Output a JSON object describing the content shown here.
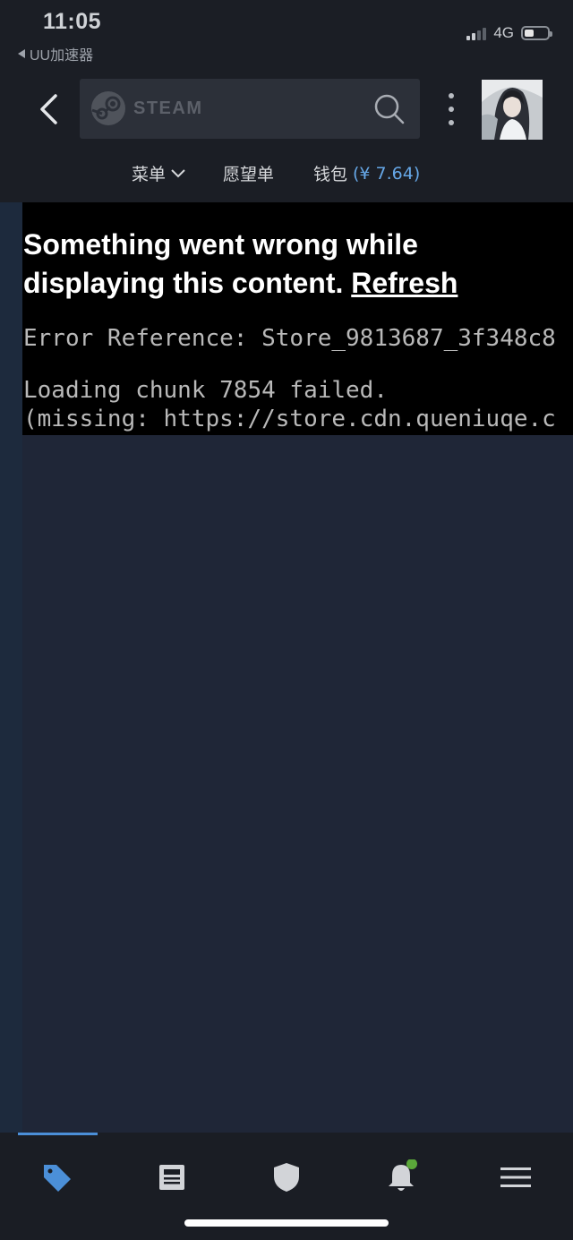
{
  "status_bar": {
    "time": "11:05",
    "back_app": "UU加速器",
    "network": "4G",
    "battery_level": 0.4
  },
  "header": {
    "search_brand": "STEAM",
    "nav": {
      "menu_label": "菜单",
      "wishlist_label": "愿望单",
      "wallet_label": "钱包",
      "wallet_balance": "(¥ 7.64)"
    }
  },
  "error": {
    "title": "Something went wrong while displaying this content.",
    "refresh_label": "Refresh",
    "reference": "Error Reference: Store_9813687_3f348c8",
    "loading_line": "Loading chunk 7854 failed.",
    "missing_line": "(missing: https://store.cdn.queniuqe.c"
  },
  "tabbar": {
    "tabs": [
      {
        "icon": "tag-icon",
        "active": true,
        "color": "#4b8fd8"
      },
      {
        "icon": "news-icon",
        "active": false
      },
      {
        "icon": "shield-icon",
        "active": false
      },
      {
        "icon": "bell-icon",
        "active": false,
        "badge": true,
        "badge_color": "#5ba83a"
      },
      {
        "icon": "hamburger-icon",
        "active": false
      }
    ]
  },
  "colors": {
    "accent": "#4b8fd8",
    "background": "#1f2637",
    "header_bg": "#1b1e25",
    "wallet_balance": "#66a8e8"
  }
}
